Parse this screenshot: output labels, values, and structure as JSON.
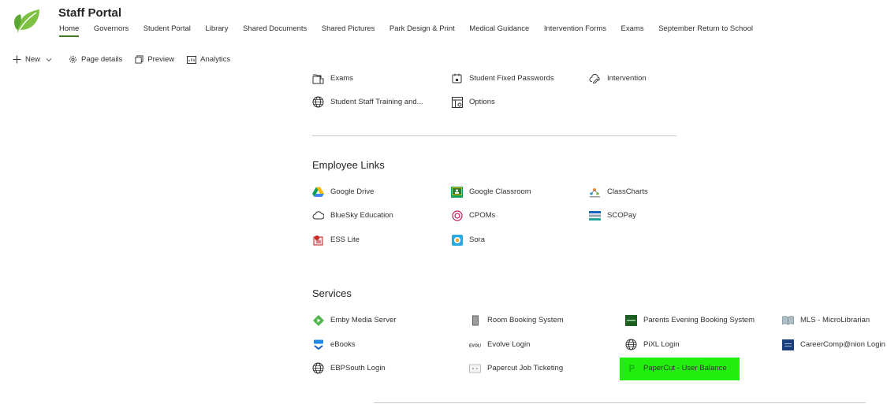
{
  "site": {
    "title": "Staff Portal"
  },
  "nav": [
    "Home",
    "Governors",
    "Student Portal",
    "Library",
    "Shared Documents",
    "Shared Pictures",
    "Park Design & Print",
    "Medical Guidance",
    "Intervention Forms",
    "Exams",
    "September Return to School"
  ],
  "commands": {
    "new": "New",
    "page_details": "Page details",
    "preview": "Preview",
    "analytics": "Analytics"
  },
  "top_links": [
    "Exams",
    "Student Fixed Passwords",
    "Intervention",
    "Student Staff Training and...",
    "Options"
  ],
  "employee": {
    "title": "Employee Links",
    "links": [
      "Google Drive",
      "Google Classroom",
      "ClassCharts",
      "BlueSky Education",
      "CPOMs",
      "SCOPay",
      "ESS Lite",
      "Sora"
    ]
  },
  "services": {
    "title": "Services",
    "links": [
      "Emby Media Server",
      "Room Booking System",
      "Parents Evening Booking System",
      "MLS - MicroLibrarian",
      "eBooks",
      "Evolve Login",
      "PiXL Login",
      "CareerComp@nion Login",
      "EBPSouth Login",
      "Papercut Job Ticketing",
      "PaperCut - User Balance"
    ]
  },
  "colors": {
    "accent": "#3f7d1e",
    "highlight": "#22ee0d"
  }
}
